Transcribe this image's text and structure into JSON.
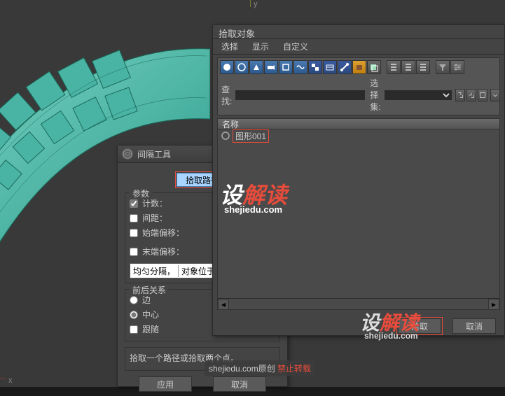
{
  "viewport": {
    "axis_y_label": "y",
    "axis_x_label": "x"
  },
  "spacing_dialog": {
    "title": "间隔工具",
    "pick_path_btn": "拾取路径",
    "params_label": "参数",
    "count_label": "计数：",
    "spacing_label": "间距：",
    "start_offset_label": "始端偏移：",
    "end_offset_label": "末端偏移：",
    "context_divide": "均匀分隔，",
    "context_objects": "对象位于",
    "relation_label": "前后关系",
    "edge_label": "边",
    "center_label": "中心",
    "follow_label": "跟随",
    "hint": "拾取一个路径或拾取两个点。",
    "apply_btn": "应用",
    "cancel_btn": "取消"
  },
  "pick_dialog": {
    "title": "拾取对象",
    "menu_select": "选择",
    "menu_display": "显示",
    "menu_custom": "自定义",
    "search_label": "查找:",
    "selset_label": "选择集:",
    "column_name": "名称",
    "items": [
      {
        "name": "图形001"
      }
    ],
    "pick_btn": "拾取",
    "cancel_btn": "取消"
  },
  "watermark": {
    "brand_cn1": "设",
    "brand_cn2": "解读",
    "brand_url": "shejiedu.com",
    "footer_text1": "shejiedu.com原创 ",
    "footer_text2": "禁止转载"
  }
}
